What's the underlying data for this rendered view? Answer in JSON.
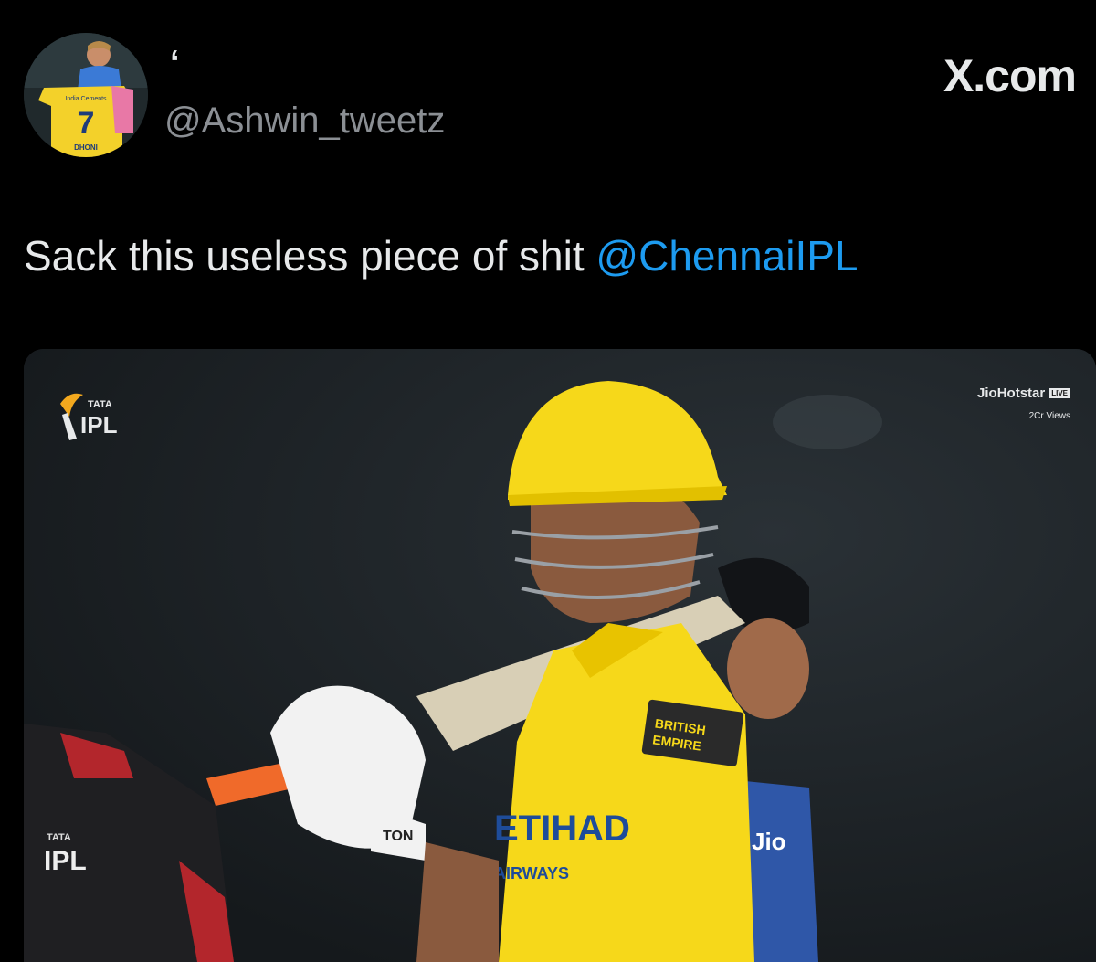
{
  "header": {
    "display_name": "‘",
    "handle": "@Ashwin_tweetz",
    "brand": "X.com",
    "avatar_jersey_number": "7",
    "avatar_jersey_name": "DHONI",
    "avatar_jersey_sponsor": "India Cements"
  },
  "tweet": {
    "text": "Sack this useless piece of shit ",
    "mention": "@ChennaiIPL"
  },
  "media": {
    "logo_top": "TATA",
    "logo_bottom": "IPL",
    "broadcaster": "JioHotstar",
    "live_label": "LIVE",
    "views": "2Cr Views",
    "jersey_sponsor_chest": "ETIHAD",
    "jersey_sponsor_chest_sub": "AIRWAYS",
    "sleeve_badge_1": "BRITISH",
    "sleeve_badge_2": "EMPIRE",
    "glove_brand": "TON",
    "umpire_logo_top": "TATA",
    "umpire_logo_bottom": "IPL",
    "background_sign": "Jio"
  },
  "colors": {
    "background": "#000000",
    "text": "#e7e9ea",
    "handle": "#8b8f94",
    "mention": "#1d9bf0",
    "csk_yellow": "#f6d81a"
  }
}
